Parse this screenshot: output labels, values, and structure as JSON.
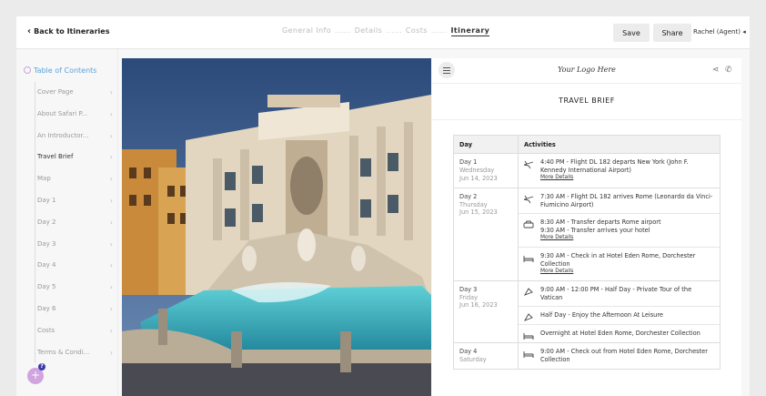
{
  "topbar": {
    "back_label": "Back to Itineraries",
    "steps": [
      {
        "label": "General Info"
      },
      {
        "label": "Details"
      },
      {
        "label": "Costs"
      },
      {
        "label": "Itinerary"
      }
    ],
    "separator": "......",
    "save_label": "Save",
    "share_label": "Share",
    "agent_label": "Rachel (Agent)"
  },
  "sidebar": {
    "heading": "Table of Contents",
    "items": [
      {
        "label": "Cover Page"
      },
      {
        "label": "About Safari P..."
      },
      {
        "label": "An Introductor..."
      },
      {
        "label": "Travel Brief"
      },
      {
        "label": "Map"
      },
      {
        "label": "Day 1"
      },
      {
        "label": "Day 2"
      },
      {
        "label": "Day 3"
      },
      {
        "label": "Day 4"
      },
      {
        "label": "Day 5"
      },
      {
        "label": "Day 6"
      },
      {
        "label": "Costs"
      },
      {
        "label": "Terms & Condi..."
      }
    ],
    "fab_label": "+",
    "fab_badge": "?"
  },
  "doc": {
    "logo": "Your Logo Here",
    "title": "TRAVEL BRIEF",
    "col_day": "Day",
    "col_activities": "Activities",
    "more_label": "More Details",
    "days": [
      {
        "day": "Day 1",
        "weekday": "Wednesday",
        "date": "Jun 14, 2023",
        "activities": [
          "4:40 PM - Flight DL 182 departs New York (John F. Kennedy International Airport)"
        ]
      },
      {
        "day": "Day 2",
        "weekday": "Thursday",
        "date": "Jun 15, 2023",
        "activities": [
          "7:30 AM - Flight DL 182 arrives Rome (Leonardo da Vinci-Fiumicino Airport)",
          "8:30 AM - Transfer departs Rome airport",
          "9:30 AM - Transfer arrives your hotel",
          "9:30 AM - Check in at Hotel Eden Rome, Dorchester Collection"
        ]
      },
      {
        "day": "Day 3",
        "weekday": "Friday",
        "date": "Jun 16, 2023",
        "activities": [
          "9:00 AM - 12:00 PM - Half Day - Private Tour of the Vatican",
          "Half Day - Enjoy the Afternoon At Leisure",
          "Overnight at Hotel Eden Rome, Dorchester Collection"
        ]
      },
      {
        "day": "Day 4",
        "weekday": "Saturday",
        "date": "",
        "activities": [
          "9:00 AM - Check out from Hotel Eden Rome, Dorchester Collection"
        ]
      }
    ]
  },
  "colors": {
    "accent": "#5aa3d9",
    "fab": "#cfa4df",
    "badge": "#3a3aa8"
  },
  "icons": {
    "back": "chevron-left-icon",
    "agent": "caret-left-icon",
    "menu": "hamburger-icon",
    "share": "share-icon",
    "phone": "phone-icon",
    "flight": "plane-icon",
    "transfer": "car-icon",
    "hotel": "bed-icon",
    "tour": "ticket-icon"
  }
}
